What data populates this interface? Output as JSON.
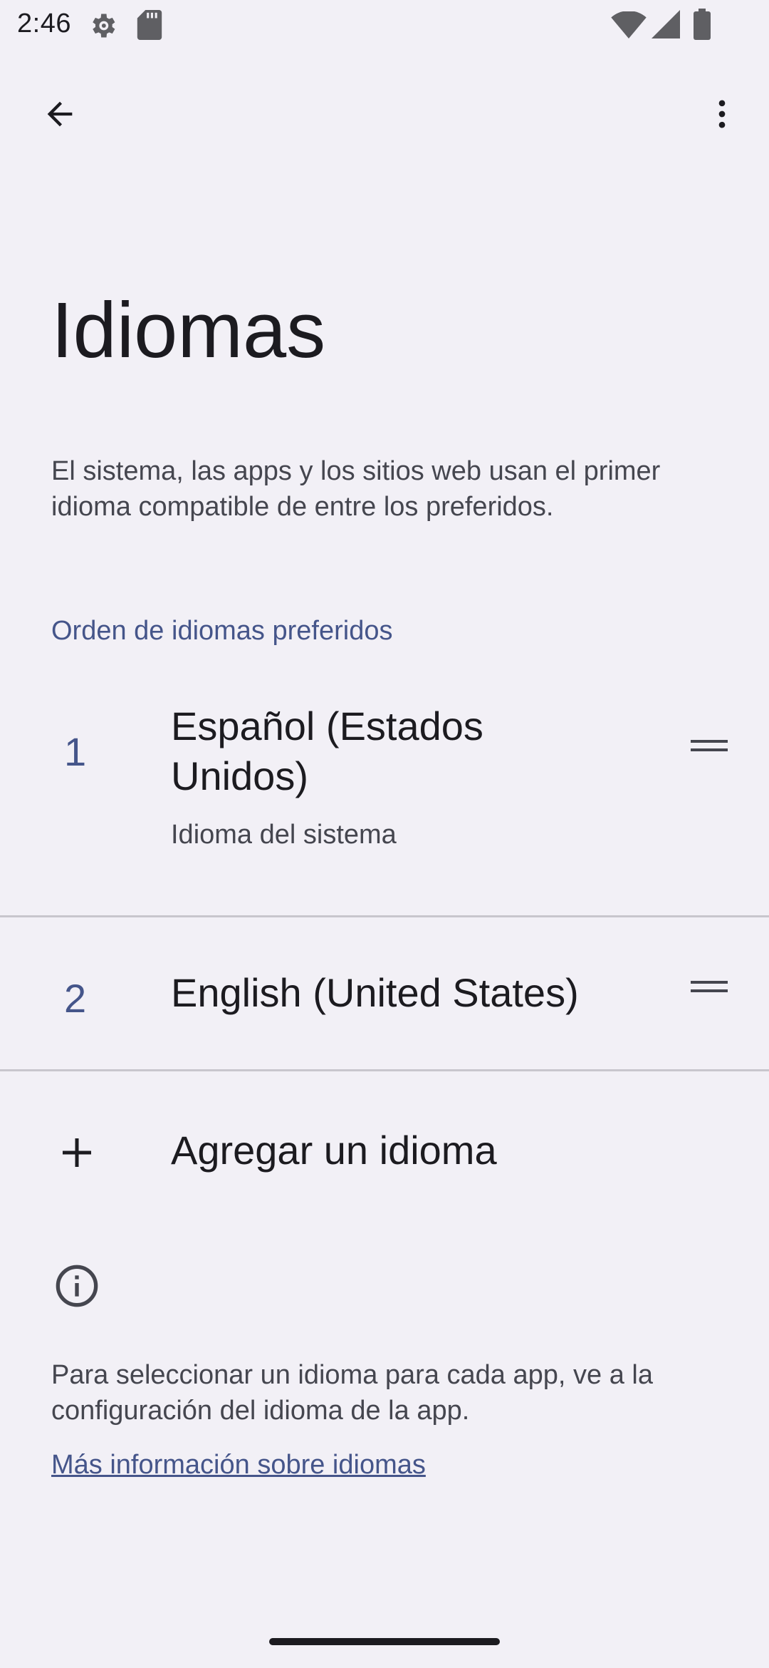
{
  "status_bar": {
    "time": "2:46",
    "icons": [
      "gear-icon",
      "sd-card-icon",
      "wifi-icon",
      "signal-icon",
      "battery-icon"
    ]
  },
  "toolbar": {
    "back_icon": "arrow-back-icon",
    "more_icon": "more-vert-icon"
  },
  "page": {
    "title": "Idiomas",
    "description": "El sistema, las apps y los sitios web usan el primer idioma compatible de entre los preferidos."
  },
  "preferred": {
    "header": "Orden de idiomas preferidos",
    "items": [
      {
        "number": "1",
        "name": "Español (Estados Unidos)",
        "subtitle": "Idioma del sistema"
      },
      {
        "number": "2",
        "name": "English (United States)",
        "subtitle": ""
      }
    ]
  },
  "add_language": {
    "label": "Agregar un idioma"
  },
  "info": {
    "text": "Para seleccionar un idioma para cada app, ve a la configuración del idioma de la app.",
    "link": "Más información sobre idiomas"
  },
  "colors": {
    "background": "#f2f0f6",
    "accent": "#45558a",
    "text_primary": "#1c1b20",
    "text_secondary": "#45464f"
  }
}
